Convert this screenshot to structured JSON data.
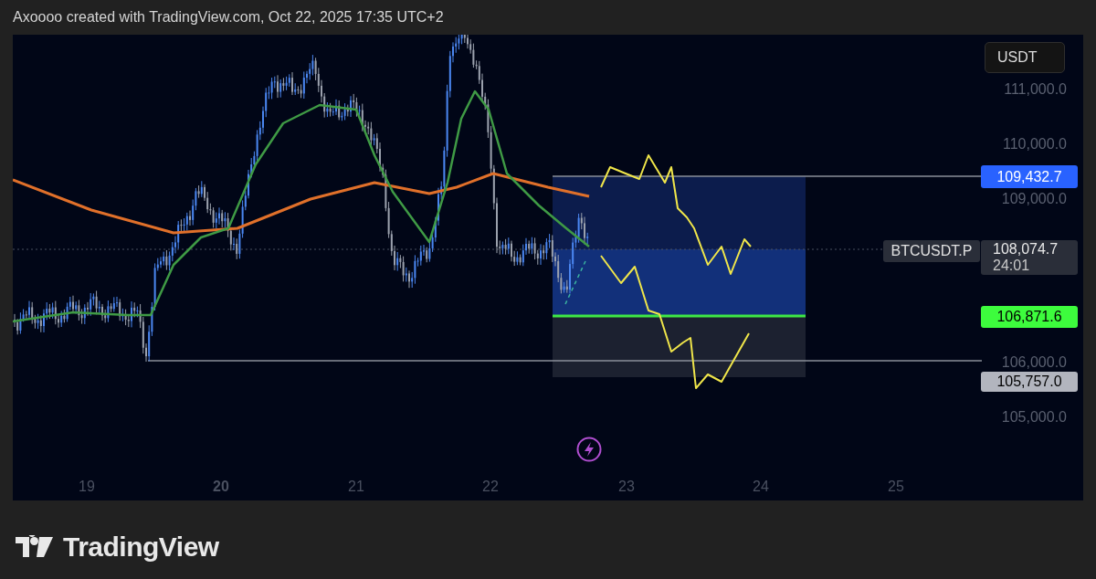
{
  "header": {
    "attribution": "Axoooo created with TradingView.com, Oct 22, 2025 17:35 UTC+2"
  },
  "chart": {
    "currency": "USDT",
    "price_ticks": [
      {
        "label": "111,000.0"
      },
      {
        "label": "110,000.0"
      },
      {
        "label": "109,000.0"
      },
      {
        "label": "106,000.0"
      },
      {
        "label": "105,000.0"
      }
    ],
    "price_labels": [
      {
        "kind": "target",
        "text": "109,432.7"
      },
      {
        "kind": "last",
        "symbol": "BTCUSDT.P",
        "price": "108,074.7",
        "countdown": "24:01"
      },
      {
        "kind": "entry",
        "text": "106,871.6"
      },
      {
        "kind": "stop",
        "text": "105,757.0"
      }
    ],
    "date_ticks": [
      {
        "label": "19",
        "bold": false
      },
      {
        "label": "20",
        "bold": true
      },
      {
        "label": "21",
        "bold": false
      },
      {
        "label": "22",
        "bold": false
      },
      {
        "label": "23",
        "bold": false
      },
      {
        "label": "24",
        "bold": false
      },
      {
        "label": "25",
        "bold": false
      }
    ]
  },
  "footer": {
    "brand": "TradingView"
  }
}
